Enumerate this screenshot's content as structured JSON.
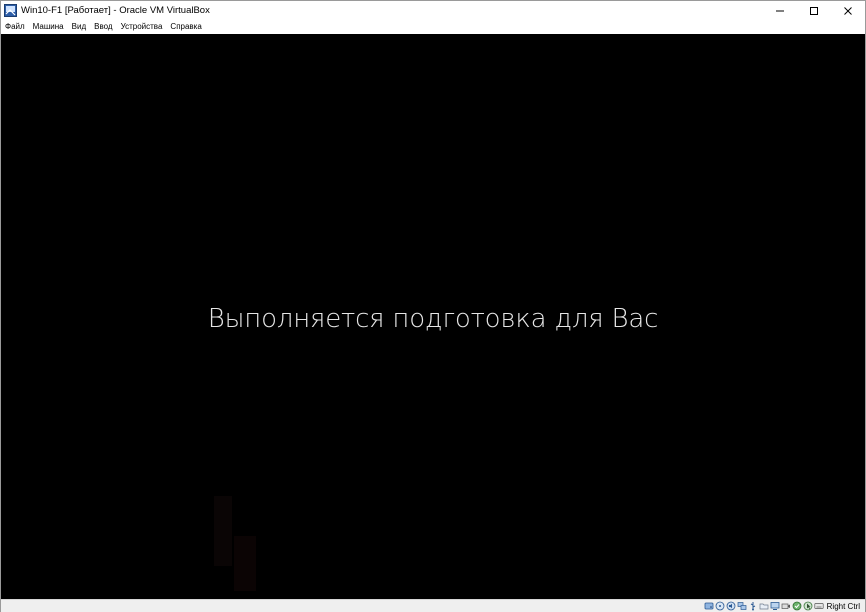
{
  "window": {
    "title": "Win10-F1 [Работает] - Oracle VM VirtualBox",
    "controls": [
      "minimize",
      "maximize",
      "close"
    ]
  },
  "menu": {
    "items": [
      {
        "label": "Файл"
      },
      {
        "label": "Машина"
      },
      {
        "label": "Вид"
      },
      {
        "label": "Ввод"
      },
      {
        "label": "Устройства"
      },
      {
        "label": "Справка"
      }
    ]
  },
  "vm": {
    "message": "Выполняется подготовка для Вас",
    "background": "#000000"
  },
  "statusbar": {
    "icons": [
      "hard-disk-icon",
      "optical-drive-icon",
      "audio-icon",
      "network-icon",
      "usb-icon",
      "shared-folders-icon",
      "display-icon",
      "video-capture-icon",
      "virtualization-icon",
      "mouse-integration-icon",
      "keyboard-icon"
    ],
    "host_key": "Right Ctrl"
  }
}
